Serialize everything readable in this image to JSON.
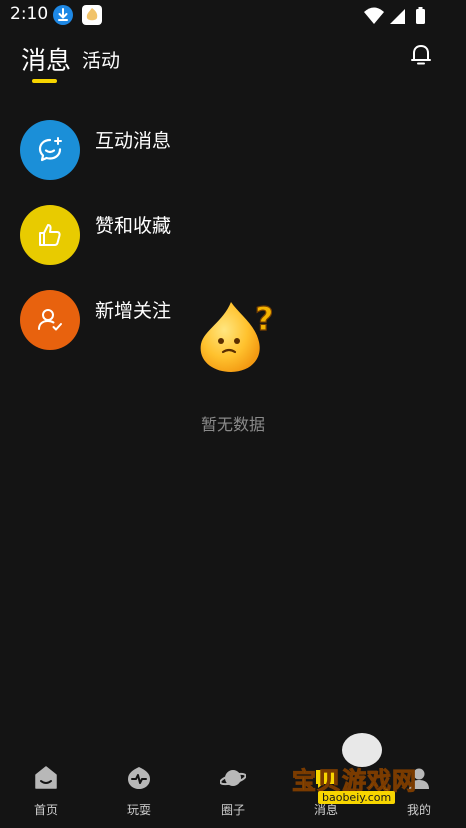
{
  "status_bar": {
    "time": "2:10",
    "icons": [
      "download-icon",
      "app-notification-icon",
      "wifi-icon",
      "cellular-signal-icon",
      "battery-icon"
    ]
  },
  "header": {
    "tabs": [
      {
        "label": "消息",
        "active": true
      },
      {
        "label": "活动",
        "active": false
      }
    ],
    "accent_color": "#F7D500",
    "notification_icon": "bell-icon"
  },
  "categories": [
    {
      "label": "互动消息",
      "icon": "chat-sparkle-icon",
      "color": "#1B8FD8"
    },
    {
      "label": "赞和收藏",
      "icon": "thumbs-up-icon",
      "color": "#E8CB00"
    },
    {
      "label": "新增关注",
      "icon": "user-check-icon",
      "color": "#E8620E"
    }
  ],
  "empty_state": {
    "icon": "confused-flame-mascot-icon",
    "text": "暂无数据"
  },
  "bottom_nav": {
    "items": [
      {
        "label": "首页",
        "icon": "home-face-icon"
      },
      {
        "label": "玩耍",
        "icon": "play-pulse-icon"
      },
      {
        "label": "圈子",
        "icon": "planet-icon"
      },
      {
        "label": "消息",
        "icon": "message-icon"
      },
      {
        "label": "我的",
        "icon": "profile-icon"
      }
    ]
  },
  "watermark": {
    "text": "宝贝游戏网",
    "url": "baobeiy.com"
  }
}
